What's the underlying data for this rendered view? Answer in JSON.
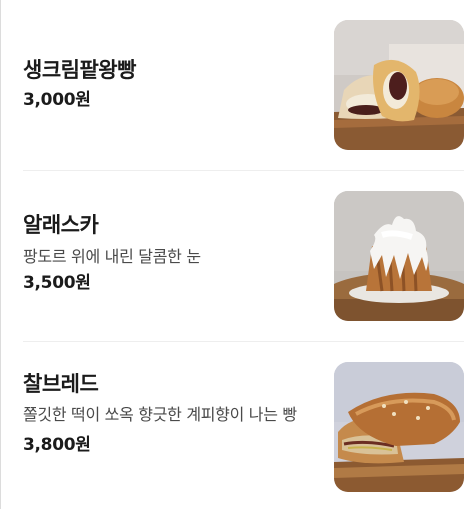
{
  "menu": {
    "items": [
      {
        "name": "생크림팥왕빵",
        "description": "",
        "price": "3,000원",
        "image": "cream-red-bean-bun-photo"
      },
      {
        "name": "알래스카",
        "description": "팡도르 위에 내린 달콤한 눈",
        "price": "3,500원",
        "image": "pandoro-snow-sugar-photo"
      },
      {
        "name": "찰브레드",
        "description": "쫄깃한 떡이 쏘옥 향긋한 계피향이 나는 빵",
        "price": "3,800원",
        "image": "mochi-cinnamon-bread-photo"
      }
    ]
  },
  "colors": {
    "text_primary": "#1b1b1b",
    "text_secondary": "#4a4a4a",
    "divider": "#eeeeee"
  }
}
